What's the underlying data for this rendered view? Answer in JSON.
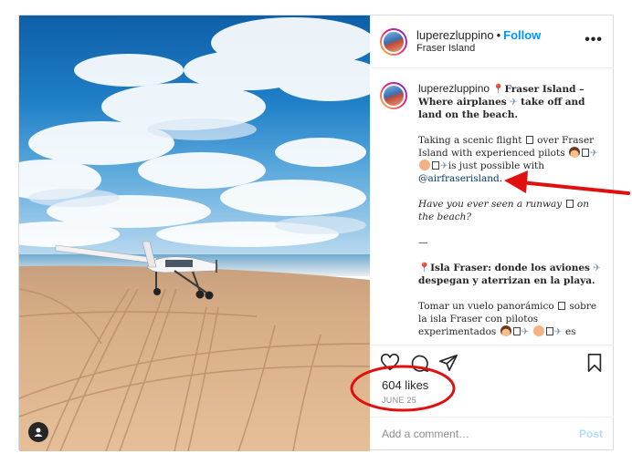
{
  "header": {
    "username": "luperezluppino",
    "separator": "•",
    "follow_label": "Follow",
    "location": "Fraser Island",
    "more_glyph": "•••"
  },
  "caption": {
    "username": "luperezluppino",
    "title_en": "Fraser Island – Where airplanes",
    "title_en_tail": "take off and land on the beach.",
    "p1_a": "Taking a scenic flight",
    "p1_b": "over Fraser Island with experienced pilots",
    "p1_c": "is just possible with",
    "mention": "@airfraserisland",
    "p1_end": ".",
    "q_a": "Have you ever seen a runway",
    "q_b": "on the beach?",
    "divider": "—",
    "title_es": "Isla Fraser: donde los aviones",
    "title_es_tail": "despegan y aterrizan en la playa.",
    "p2_a": "Tomar un vuelo panorámico",
    "p2_b": "sobre la isla Fraser con pilotos experimentados",
    "p2_c": "es"
  },
  "actions": {
    "icons": [
      "heart-icon",
      "comment-icon",
      "share-icon",
      "bookmark-icon"
    ],
    "likes": "604 likes",
    "date": "JUNE 25"
  },
  "comment": {
    "placeholder": "Add a comment…",
    "post_label": "Post"
  },
  "colors": {
    "link": "#0095f6",
    "mention": "#00376b",
    "annotation_red": "#e01010",
    "post_disabled": "#b3dbff"
  }
}
